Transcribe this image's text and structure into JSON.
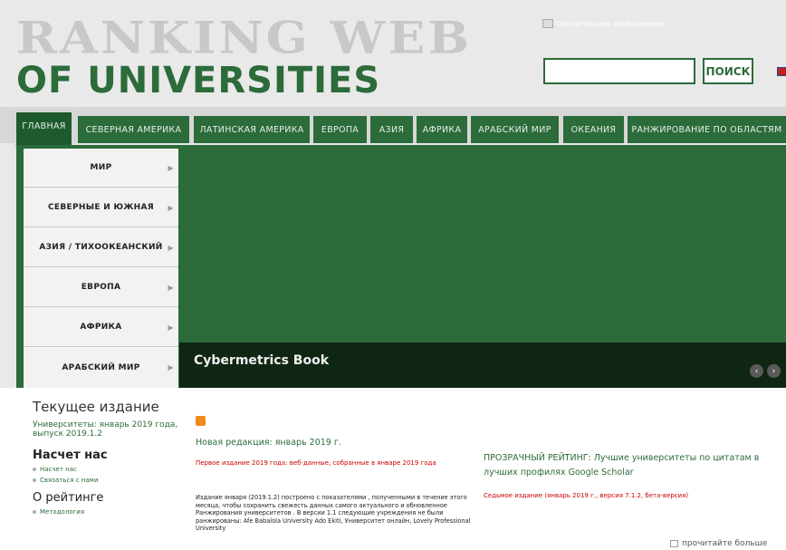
{
  "header": {
    "logo_line1": "RANKING WEB",
    "logo_line2": "OF UNIVERSITIES",
    "broken_image_alt": "Описательное изображение",
    "search_button": "ПОИСК",
    "search_value": ""
  },
  "nav": {
    "tabs": [
      {
        "label": "ГЛАВНАЯ"
      },
      {
        "label": "СЕВЕРНАЯ АМЕРИКА"
      },
      {
        "label": "ЛАТИНСКАЯ АМЕРИКА"
      },
      {
        "label": "ЕВРОПА"
      },
      {
        "label": "АЗИЯ"
      },
      {
        "label": "АФРИКА"
      },
      {
        "label": "АРАБСКИЙ МИР"
      },
      {
        "label": "ОКЕАНИЯ"
      },
      {
        "label": "РАНЖИРОВАНИЕ ПО ОБЛАСТЯМ"
      }
    ]
  },
  "side_menu": {
    "items": [
      {
        "label": "МИР"
      },
      {
        "label": "СЕВЕРНЫЕ И ЮЖНАЯ"
      },
      {
        "label": "АЗИЯ / ТИХООКЕАНСКИЙ"
      },
      {
        "label": "ЕВРОПА"
      },
      {
        "label": "АФРИКА"
      },
      {
        "label": "АРАБСКИЙ МИР"
      }
    ]
  },
  "hero": {
    "caption": "Cybermetrics Book"
  },
  "left": {
    "current_title": "Текущее издание",
    "current_link": "Университеты: январь 2019 года, выпуск 2019.1.2",
    "about_title": "Насчет нас",
    "about_items": [
      "Насчет нас",
      "Связаться с нами"
    ],
    "rating_title": "О рейтинге",
    "rating_items": [
      "Методология"
    ]
  },
  "main": {
    "news_title": "Новая редакция: январь 2019 г.",
    "red_intro": "Первое издание 2019 года: веб-данные, собранные в январе 2019 года",
    "body": "Издание января (2019.1.2) построено с показателями , полученными в течение этого месяца, чтобы сохранить свежесть данных самого актуального и обновленное Ранжирования университетов . В версии 1.1 следующие учреждения не были ранжированы: Afe Babalola University Ado Ekiti, Университет онлайн, Lovely Professional University",
    "transparent": "ПРОЗРАЧНЫЙ РЕЙТИНГ: Лучшие университеты по цитатам в лучших профилях Google Scholar",
    "red_seventh": "Седьмое издание (январь 2019 г., версия 7.1.2, бета-версия)",
    "read_more": "прочитайте больше"
  }
}
